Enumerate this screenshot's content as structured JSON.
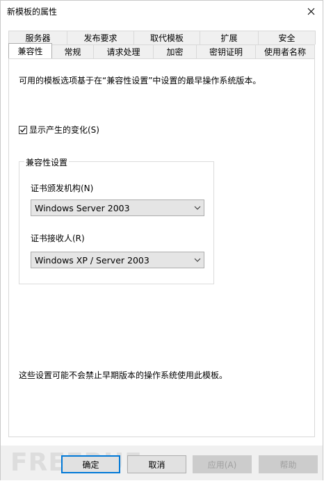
{
  "window": {
    "title": "新模板的属性"
  },
  "tabs_back": [
    "服务器",
    "发布要求",
    "取代模板",
    "扩展",
    "安全"
  ],
  "tabs_front": [
    "兼容性",
    "常规",
    "请求处理",
    "加密",
    "密钥证明",
    "使用者名称"
  ],
  "active_tab": "兼容性",
  "panel": {
    "description": "可用的模板选项基于在“兼容性设置”中设置的最早操作系统版本。",
    "show_changes": {
      "label": "显示产生的变化(S)",
      "checked": true
    },
    "group": {
      "title": "兼容性设置",
      "ca_label": "证书颁发机构(N)",
      "ca_value": "Windows Server 2003",
      "recipient_label": "证书接收人(R)",
      "recipient_value": "Windows XP / Server 2003"
    },
    "note": "这些设置可能不会禁止早期版本的操作系统使用此模板。"
  },
  "buttons": {
    "ok": "确定",
    "cancel": "取消",
    "apply": "应用(A)",
    "help": "帮助"
  },
  "watermark": "FREEBUF",
  "colors": {
    "accent": "#0078d7",
    "tab_bg": "#f0f0f0",
    "select_bg": "#e5e5e5",
    "footer_bg": "#f0f0f0"
  }
}
